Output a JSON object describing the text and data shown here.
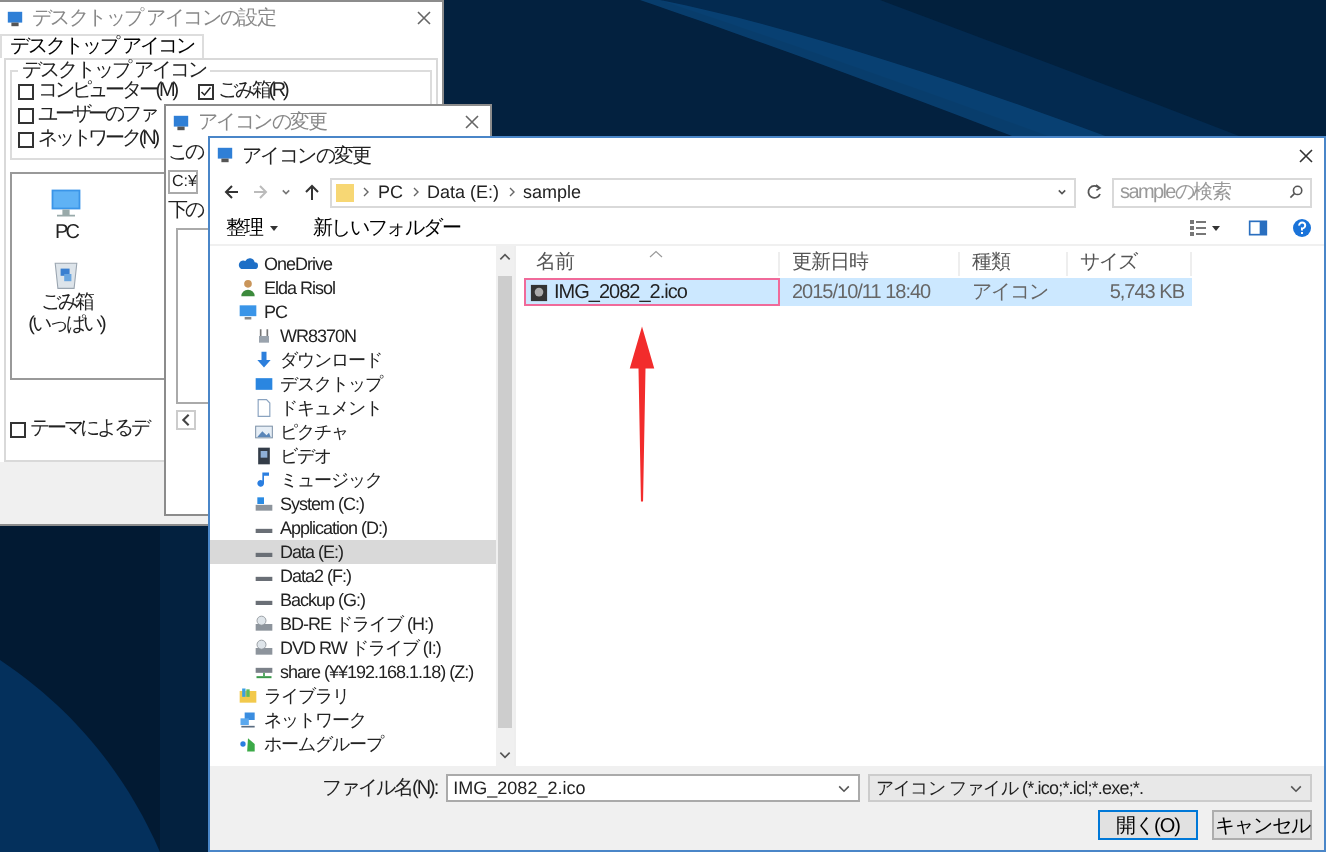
{
  "settings_window": {
    "title": "デスクトップ アイコンの設定",
    "tab": {
      "label": "デスクトップ アイコン",
      "selected": true
    },
    "group_title": "デスクトップ アイコン",
    "checkbox_rows": [
      [
        {
          "label": "コンピューター(M)",
          "checked": false
        },
        {
          "label": "ごみ箱(R)",
          "checked": true
        }
      ],
      [
        {
          "label": "ユーザーのファ",
          "checked": false
        }
      ],
      [
        {
          "label": "ネットワーク(N)",
          "checked": false
        }
      ]
    ],
    "icons": [
      {
        "label": "PC",
        "kind": "pc"
      },
      {
        "label": "ごみ箱",
        "sublabel": "(いっぱい)",
        "kind": "recycle-bin"
      }
    ],
    "theme_checkbox": {
      "label": "テーマによるデ",
      "checked": false
    }
  },
  "change_icon_window": {
    "title": "アイコンの変更",
    "texts": [
      "この",
      "下の"
    ],
    "path": "C:¥"
  },
  "file_dialog": {
    "title": "アイコンの変更",
    "path": [
      "PC",
      "Data (E:)",
      "sample"
    ],
    "search": {
      "placeholder": "sampleの検索"
    },
    "toolbar": [
      {
        "label": "整理",
        "kind": "menu"
      },
      {
        "label": "新しいフォルダー",
        "kind": "plain"
      }
    ],
    "nav": [
      {
        "label": "OneDrive",
        "kind": "cloud",
        "selected": false
      },
      {
        "label": "Elda Risol",
        "kind": "user",
        "selected": false
      },
      {
        "label": "PC",
        "kind": "pc",
        "selected": false,
        "children": [
          {
            "label": "WR8370N",
            "kind": "router",
            "selected": false
          },
          {
            "label": "ダウンロード",
            "kind": "download",
            "selected": false
          },
          {
            "label": "デスクトップ",
            "kind": "desktop",
            "selected": false
          },
          {
            "label": "ドキュメント",
            "kind": "document",
            "selected": false
          },
          {
            "label": "ピクチャ",
            "kind": "picture",
            "selected": false
          },
          {
            "label": "ビデオ",
            "kind": "video",
            "selected": false
          },
          {
            "label": "ミュージック",
            "kind": "music",
            "selected": false
          },
          {
            "label": "System (C:)",
            "kind": "system-drive",
            "selected": false
          },
          {
            "label": "Application (D:)",
            "kind": "drive",
            "selected": false
          },
          {
            "label": "Data (E:)",
            "kind": "drive",
            "selected": true
          },
          {
            "label": "Data2 (F:)",
            "kind": "drive",
            "selected": false
          },
          {
            "label": "Backup (G:)",
            "kind": "drive",
            "selected": false
          },
          {
            "label": "BD-RE ドライブ (H:)",
            "kind": "optical",
            "selected": false
          },
          {
            "label": "DVD RW ドライブ (I:)",
            "kind": "optical",
            "selected": false
          },
          {
            "label": "share (¥¥192.168.1.18) (Z:)",
            "kind": "network-drive",
            "selected": false
          }
        ]
      },
      {
        "label": "ライブラリ",
        "kind": "library",
        "selected": false
      },
      {
        "label": "ネットワーク",
        "kind": "network",
        "selected": false
      },
      {
        "label": "ホームグループ",
        "kind": "homegroup",
        "selected": false
      }
    ],
    "columns": [
      "名前",
      "更新日時",
      "種類",
      "サイズ"
    ],
    "files": [
      {
        "name": "IMG_2082_2.ico",
        "modified": "2015/10/11 18:40",
        "type": "アイコン",
        "size": "5,743 KB",
        "selected": true,
        "highlighted": true
      }
    ],
    "filename_label": "ファイル名(N):",
    "filename": "IMG_2082_2.ico",
    "filetype": "アイコン ファイル (*.ico;*.icl;*.exe;*.",
    "buttons": [
      {
        "label": "開く(O)",
        "default": true
      },
      {
        "label": "キャンセル",
        "default": false
      }
    ]
  }
}
